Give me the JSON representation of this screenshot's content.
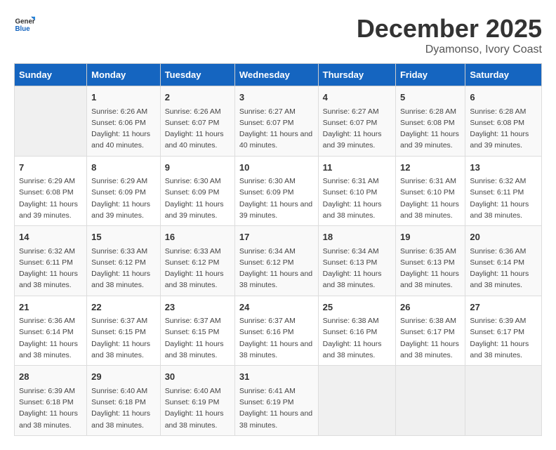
{
  "header": {
    "logo_general": "General",
    "logo_blue": "Blue",
    "month": "December 2025",
    "location": "Dyamonso, Ivory Coast"
  },
  "weekdays": [
    "Sunday",
    "Monday",
    "Tuesday",
    "Wednesday",
    "Thursday",
    "Friday",
    "Saturday"
  ],
  "weeks": [
    [
      {
        "day": "",
        "sunrise": "",
        "sunset": "",
        "daylight": ""
      },
      {
        "day": "1",
        "sunrise": "Sunrise: 6:26 AM",
        "sunset": "Sunset: 6:06 PM",
        "daylight": "Daylight: 11 hours and 40 minutes."
      },
      {
        "day": "2",
        "sunrise": "Sunrise: 6:26 AM",
        "sunset": "Sunset: 6:07 PM",
        "daylight": "Daylight: 11 hours and 40 minutes."
      },
      {
        "day": "3",
        "sunrise": "Sunrise: 6:27 AM",
        "sunset": "Sunset: 6:07 PM",
        "daylight": "Daylight: 11 hours and 40 minutes."
      },
      {
        "day": "4",
        "sunrise": "Sunrise: 6:27 AM",
        "sunset": "Sunset: 6:07 PM",
        "daylight": "Daylight: 11 hours and 39 minutes."
      },
      {
        "day": "5",
        "sunrise": "Sunrise: 6:28 AM",
        "sunset": "Sunset: 6:08 PM",
        "daylight": "Daylight: 11 hours and 39 minutes."
      },
      {
        "day": "6",
        "sunrise": "Sunrise: 6:28 AM",
        "sunset": "Sunset: 6:08 PM",
        "daylight": "Daylight: 11 hours and 39 minutes."
      }
    ],
    [
      {
        "day": "7",
        "sunrise": "Sunrise: 6:29 AM",
        "sunset": "Sunset: 6:08 PM",
        "daylight": "Daylight: 11 hours and 39 minutes."
      },
      {
        "day": "8",
        "sunrise": "Sunrise: 6:29 AM",
        "sunset": "Sunset: 6:09 PM",
        "daylight": "Daylight: 11 hours and 39 minutes."
      },
      {
        "day": "9",
        "sunrise": "Sunrise: 6:30 AM",
        "sunset": "Sunset: 6:09 PM",
        "daylight": "Daylight: 11 hours and 39 minutes."
      },
      {
        "day": "10",
        "sunrise": "Sunrise: 6:30 AM",
        "sunset": "Sunset: 6:09 PM",
        "daylight": "Daylight: 11 hours and 39 minutes."
      },
      {
        "day": "11",
        "sunrise": "Sunrise: 6:31 AM",
        "sunset": "Sunset: 6:10 PM",
        "daylight": "Daylight: 11 hours and 38 minutes."
      },
      {
        "day": "12",
        "sunrise": "Sunrise: 6:31 AM",
        "sunset": "Sunset: 6:10 PM",
        "daylight": "Daylight: 11 hours and 38 minutes."
      },
      {
        "day": "13",
        "sunrise": "Sunrise: 6:32 AM",
        "sunset": "Sunset: 6:11 PM",
        "daylight": "Daylight: 11 hours and 38 minutes."
      }
    ],
    [
      {
        "day": "14",
        "sunrise": "Sunrise: 6:32 AM",
        "sunset": "Sunset: 6:11 PM",
        "daylight": "Daylight: 11 hours and 38 minutes."
      },
      {
        "day": "15",
        "sunrise": "Sunrise: 6:33 AM",
        "sunset": "Sunset: 6:12 PM",
        "daylight": "Daylight: 11 hours and 38 minutes."
      },
      {
        "day": "16",
        "sunrise": "Sunrise: 6:33 AM",
        "sunset": "Sunset: 6:12 PM",
        "daylight": "Daylight: 11 hours and 38 minutes."
      },
      {
        "day": "17",
        "sunrise": "Sunrise: 6:34 AM",
        "sunset": "Sunset: 6:12 PM",
        "daylight": "Daylight: 11 hours and 38 minutes."
      },
      {
        "day": "18",
        "sunrise": "Sunrise: 6:34 AM",
        "sunset": "Sunset: 6:13 PM",
        "daylight": "Daylight: 11 hours and 38 minutes."
      },
      {
        "day": "19",
        "sunrise": "Sunrise: 6:35 AM",
        "sunset": "Sunset: 6:13 PM",
        "daylight": "Daylight: 11 hours and 38 minutes."
      },
      {
        "day": "20",
        "sunrise": "Sunrise: 6:36 AM",
        "sunset": "Sunset: 6:14 PM",
        "daylight": "Daylight: 11 hours and 38 minutes."
      }
    ],
    [
      {
        "day": "21",
        "sunrise": "Sunrise: 6:36 AM",
        "sunset": "Sunset: 6:14 PM",
        "daylight": "Daylight: 11 hours and 38 minutes."
      },
      {
        "day": "22",
        "sunrise": "Sunrise: 6:37 AM",
        "sunset": "Sunset: 6:15 PM",
        "daylight": "Daylight: 11 hours and 38 minutes."
      },
      {
        "day": "23",
        "sunrise": "Sunrise: 6:37 AM",
        "sunset": "Sunset: 6:15 PM",
        "daylight": "Daylight: 11 hours and 38 minutes."
      },
      {
        "day": "24",
        "sunrise": "Sunrise: 6:37 AM",
        "sunset": "Sunset: 6:16 PM",
        "daylight": "Daylight: 11 hours and 38 minutes."
      },
      {
        "day": "25",
        "sunrise": "Sunrise: 6:38 AM",
        "sunset": "Sunset: 6:16 PM",
        "daylight": "Daylight: 11 hours and 38 minutes."
      },
      {
        "day": "26",
        "sunrise": "Sunrise: 6:38 AM",
        "sunset": "Sunset: 6:17 PM",
        "daylight": "Daylight: 11 hours and 38 minutes."
      },
      {
        "day": "27",
        "sunrise": "Sunrise: 6:39 AM",
        "sunset": "Sunset: 6:17 PM",
        "daylight": "Daylight: 11 hours and 38 minutes."
      }
    ],
    [
      {
        "day": "28",
        "sunrise": "Sunrise: 6:39 AM",
        "sunset": "Sunset: 6:18 PM",
        "daylight": "Daylight: 11 hours and 38 minutes."
      },
      {
        "day": "29",
        "sunrise": "Sunrise: 6:40 AM",
        "sunset": "Sunset: 6:18 PM",
        "daylight": "Daylight: 11 hours and 38 minutes."
      },
      {
        "day": "30",
        "sunrise": "Sunrise: 6:40 AM",
        "sunset": "Sunset: 6:19 PM",
        "daylight": "Daylight: 11 hours and 38 minutes."
      },
      {
        "day": "31",
        "sunrise": "Sunrise: 6:41 AM",
        "sunset": "Sunset: 6:19 PM",
        "daylight": "Daylight: 11 hours and 38 minutes."
      },
      {
        "day": "",
        "sunrise": "",
        "sunset": "",
        "daylight": ""
      },
      {
        "day": "",
        "sunrise": "",
        "sunset": "",
        "daylight": ""
      },
      {
        "day": "",
        "sunrise": "",
        "sunset": "",
        "daylight": ""
      }
    ]
  ]
}
